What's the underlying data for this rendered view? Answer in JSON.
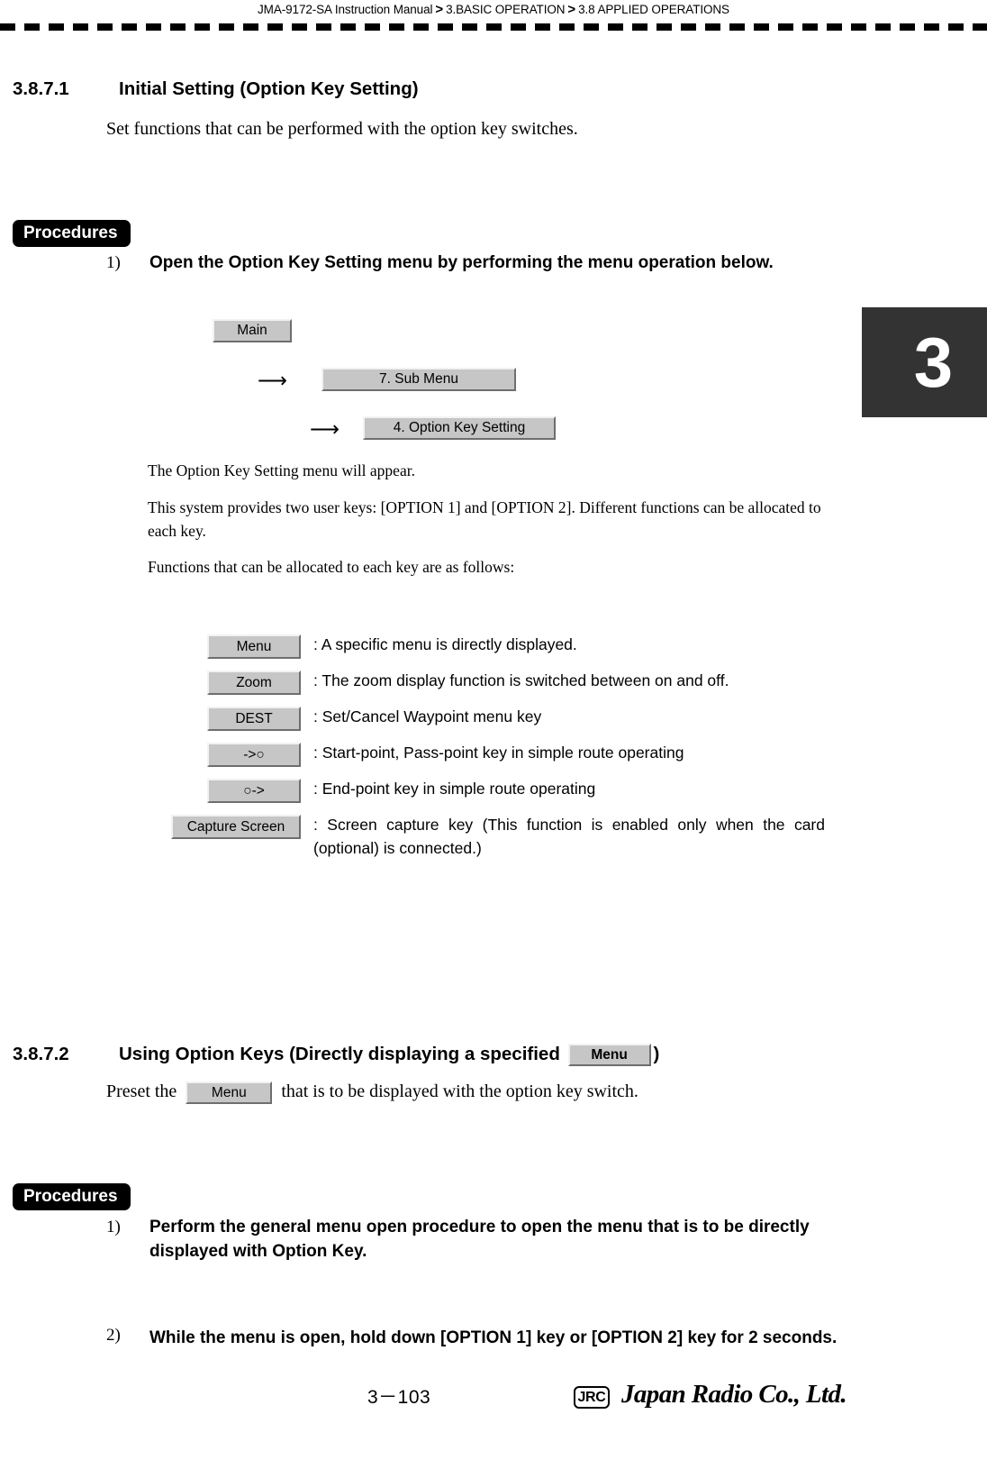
{
  "header": {
    "manual": "JMA-9172-SA Instruction Manual",
    "separator": ">",
    "chapter": "3.BASIC OPERATION",
    "section": "3.8  APPLIED OPERATIONS"
  },
  "chapter_tab": {
    "number": "3"
  },
  "section_1": {
    "number": "3.8.7.1",
    "title": "Initial Setting (Option Key Setting)",
    "intro": "Set functions that can be performed with the option key switches.",
    "procedures_tag": "Procedures",
    "step1": {
      "num": "1)",
      "text": "Open the Option Key Setting menu by performing the menu operation below."
    },
    "menu_path": {
      "main": "Main",
      "arrow": "⟶",
      "sub": "7. Sub Menu",
      "option": "4. Option Key Setting"
    },
    "after_path": [
      "The Option Key Setting menu will appear.",
      "This system provides two user keys: [OPTION 1] and [OPTION 2]. Different functions can be allocated to each key.",
      "Functions that can be allocated to each key are as follows:"
    ],
    "key_functions": [
      {
        "key": "Menu",
        "wide": false,
        "justify": false,
        "desc": ": A specific menu is directly displayed."
      },
      {
        "key": "Zoom",
        "wide": false,
        "justify": false,
        "desc": ": The zoom display function is switched between on and off."
      },
      {
        "key": "DEST",
        "wide": false,
        "justify": false,
        "desc": ": Set/Cancel Waypoint menu key"
      },
      {
        "key": "->○",
        "wide": false,
        "justify": false,
        "desc": ": Start-point, Pass-point key in simple route operating"
      },
      {
        "key": "○->",
        "wide": false,
        "justify": false,
        "desc": ": End-point key in simple route operating"
      },
      {
        "key": "Capture Screen",
        "wide": true,
        "justify": true,
        "desc": ": Screen capture key (This function is enabled only when the card (optional) is connected.)"
      }
    ]
  },
  "section_2": {
    "number": "3.8.7.2",
    "title_before": "Using Option Keys (Directly displaying a specified",
    "title_key": "Menu",
    "title_after": ")",
    "intro_before": "Preset the",
    "intro_key": "Menu",
    "intro_after": "that is to be displayed with the option key switch.",
    "procedures_tag": "Procedures",
    "steps": [
      {
        "num": "1)",
        "text": "Perform the general menu open procedure to open the menu that is to be directly displayed with Option Key."
      },
      {
        "num": "2)",
        "text": "While the menu is open, hold down [OPTION 1] key or [OPTION 2] key for 2 seconds."
      }
    ]
  },
  "footer": {
    "page_number": "3－103",
    "logo_mark": "JRC",
    "company": "Japan Radio Co., Ltd."
  }
}
